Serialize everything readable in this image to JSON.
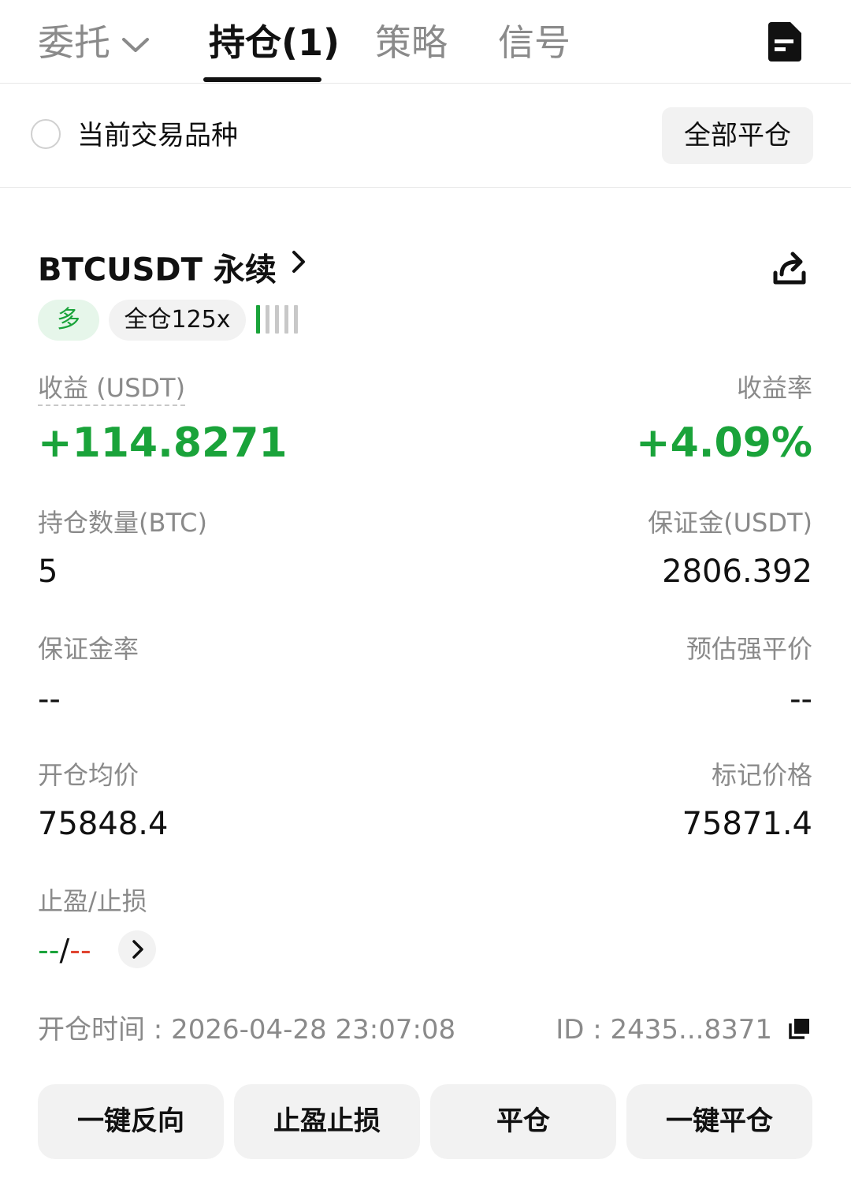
{
  "tabs": [
    {
      "label": "委托"
    },
    {
      "label": "持仓(1)"
    },
    {
      "label": "策略"
    },
    {
      "label": "信号"
    }
  ],
  "filter": {
    "current_symbol_label": "当前交易品种",
    "close_all_label": "全部平仓"
  },
  "position": {
    "symbol": "BTCUSDT 永续",
    "side": "多",
    "margin_mode": "全仓125x",
    "risk_level": 1,
    "pnl_label": "收益 (USDT)",
    "pnl_value": "+114.8271",
    "roi_label": "收益率",
    "roi_value": "+4.09%",
    "size_label": "持仓数量(BTC)",
    "size_value": "5",
    "margin_label": "保证金(USDT)",
    "margin_value": "2806.392",
    "margin_ratio_label": "保证金率",
    "margin_ratio_value": "--",
    "liq_price_label": "预估强平价",
    "liq_price_value": "--",
    "entry_price_label": "开仓均价",
    "entry_price_value": "75848.4",
    "mark_price_label": "标记价格",
    "mark_price_value": "75871.4",
    "tpsl_label": "止盈/止损",
    "tp_value": "--",
    "tpsl_sep": "/",
    "sl_value": "--",
    "open_time": "开仓时间 : 2026-04-28 23:07:08",
    "id_text": "ID : 2435...8371"
  },
  "actions": {
    "reverse": "一键反向",
    "tpsl": "止盈止损",
    "close": "平仓",
    "quick_close": "一键平仓"
  },
  "colors": {
    "accent_green": "#1aa33a",
    "loss_red": "#e0442f",
    "muted": "#8a8a8a"
  },
  "icons": [
    "chevron-down-icon",
    "document-icon",
    "chevron-right-icon",
    "share-icon",
    "copy-icon"
  ]
}
